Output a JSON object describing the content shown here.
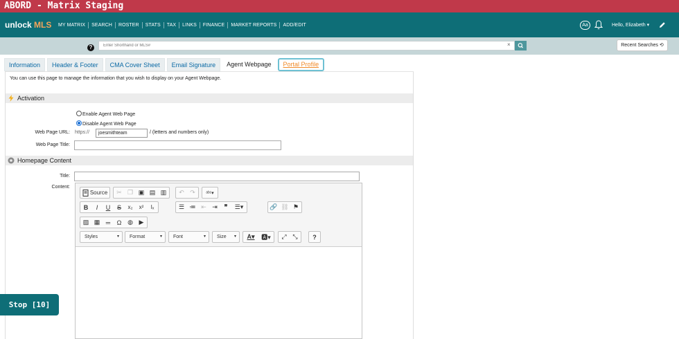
{
  "window": {
    "title": "ABORD - Matrix Staging"
  },
  "header": {
    "logo_prefix": "unlock",
    "logo_suffix": "MLS",
    "nav": [
      "MY MATRIX",
      "SEARCH",
      "ROSTER",
      "STATS",
      "TAX",
      "LINKS",
      "FINANCE",
      "MARKET REPORTS",
      "ADD/EDIT"
    ],
    "text_size_label": "Aa",
    "user_greeting": "Hello, Elizabeth ▾"
  },
  "search": {
    "placeholder": "Enter Shorthand or MLS#",
    "clear_label": "×",
    "recent_label": "Recent Searches ⟲"
  },
  "tabs": [
    "Information",
    "Header & Footer",
    "CMA Cover Sheet",
    "Email Signature",
    "Agent Webpage",
    "Portal Profile"
  ],
  "page": {
    "intro": "You can use this page to manage the information that you wish to display on your Agent Webpage.",
    "activation": {
      "heading": "Activation",
      "enable_label": "Enable Agent Web Page",
      "disable_label": "Disable Agent Web Page",
      "selected": "Disable Agent Web Page"
    },
    "url": {
      "label": "Web Page URL:",
      "prefix": "https://",
      "value": "joesmithteam",
      "hint": "/ (letters and numbers only)"
    },
    "page_title_label": "Web Page Title:",
    "homepage": {
      "heading": "Homepage Content",
      "title_label": "Title:",
      "content_label": "Content:"
    }
  },
  "editor": {
    "source_label": "Source",
    "styles_label": "Styles",
    "format_label": "Format",
    "font_label": "Font",
    "size_label": "Size",
    "help_label": "?"
  },
  "overlay": {
    "stop_label": "Stop [10]"
  },
  "colors": {
    "titlebar": "#c0394a",
    "nav": "#0e6e77",
    "accent": "#f08a28",
    "search_bar": "#c5d6d8"
  }
}
